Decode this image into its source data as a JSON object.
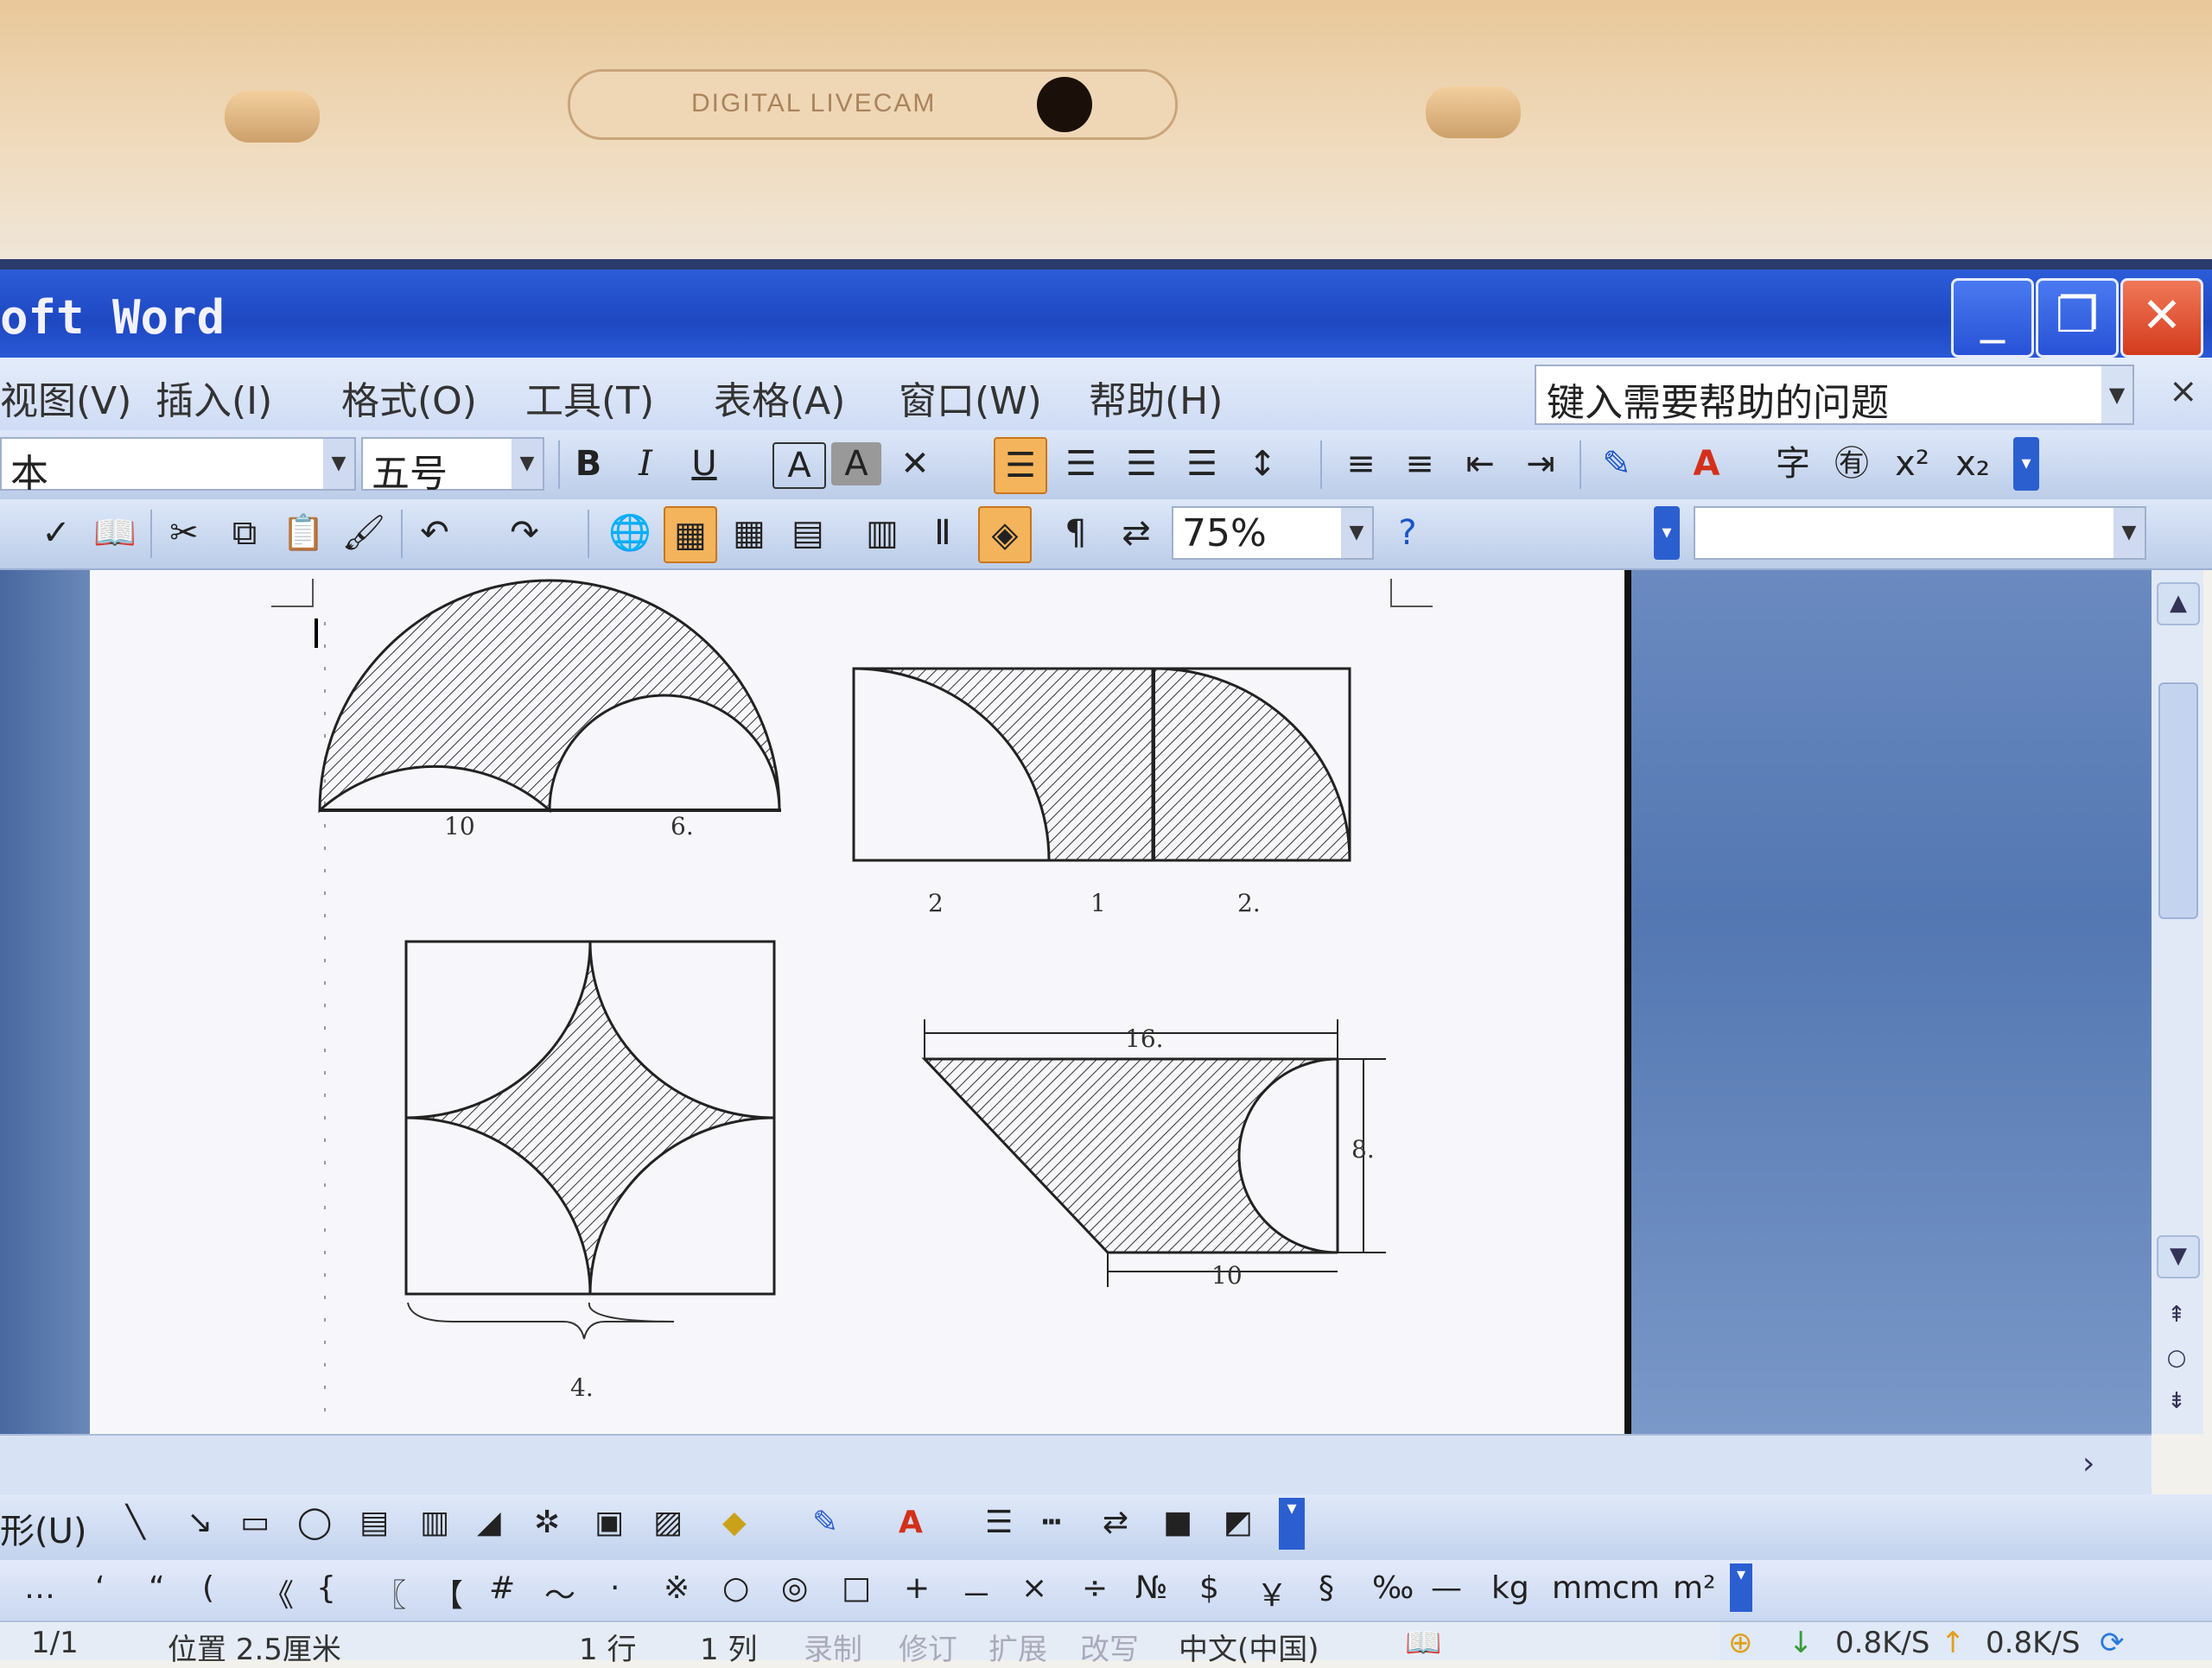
{
  "bezel": {
    "camera_label": "DIGITAL LIVECAM"
  },
  "window": {
    "title": "oft Word",
    "buttons": {
      "minimize": "_",
      "restore": "❐",
      "close": "✕"
    }
  },
  "menu": {
    "items": [
      "视图(V)",
      "插入(I)",
      "格式(O)",
      "工具(T)",
      "表格(A)",
      "窗口(W)",
      "帮助(H)"
    ],
    "help_box": "键入需要帮助的问题",
    "close_doc": "×"
  },
  "format_toolbar": {
    "font_name": "本",
    "font_size": "五号",
    "buttons": [
      "B",
      "I",
      "U",
      "A",
      "A",
      "✕"
    ]
  },
  "standard_toolbar": {
    "zoom": "75%"
  },
  "document": {
    "fig1": {
      "left": "10",
      "right": "6."
    },
    "fig2": {
      "a": "2",
      "b": "1",
      "c": "2."
    },
    "fig3": {
      "brace": "4."
    },
    "fig4": {
      "top": "16.",
      "height": "8.",
      "bottom": "10"
    }
  },
  "drawing_toolbar": {
    "menu_label": "形(U)"
  },
  "symbols": [
    "…",
    "‘",
    "“",
    "(",
    "《",
    "{",
    "〖",
    "【",
    "#",
    "～",
    "·",
    "※",
    "○",
    "◎",
    "□",
    "+",
    "－",
    "×",
    "÷",
    "№",
    "$",
    "￥",
    "§",
    "‰",
    "—",
    "kg",
    "mm",
    "cm",
    "m²"
  ],
  "status": {
    "page": "1/1",
    "position": "位置 2.5厘米",
    "line": "1 行",
    "column": "1 列",
    "modes": [
      "录制",
      "修订",
      "扩展",
      "改写"
    ],
    "language": "中文(中国)",
    "net_down": "0.8K/S",
    "net_up": "0.8K/S"
  },
  "colors": {
    "titlebar": "#2452d2",
    "accent": "#f4b45c",
    "hatch": "#333333"
  }
}
